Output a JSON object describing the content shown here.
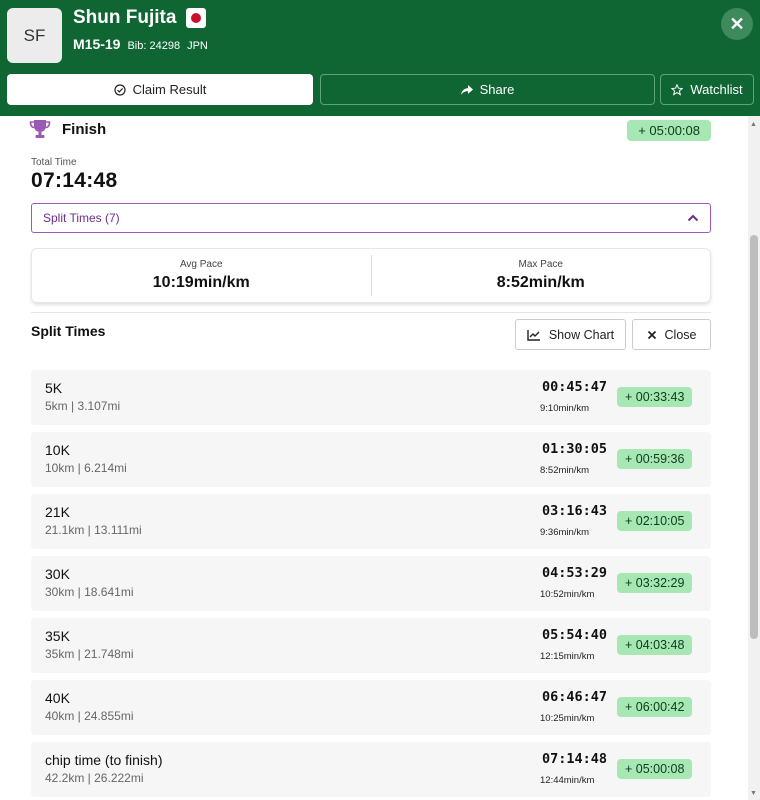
{
  "header": {
    "avatar_initials": "SF",
    "name": "Shun Fujita",
    "flag_icon": "japan-flag-icon",
    "category": "M15-19",
    "bib": "Bib: 24298",
    "country": "JPN",
    "claim_label": "Claim Result",
    "share_label": "Share",
    "watchlist_label": "Watchlist",
    "brand_color": "#0f6633"
  },
  "result": {
    "finish_label": "Finish",
    "finish_diff": "+ 05:00:08",
    "total_time_label": "Total Time",
    "total_time": "07:14:48",
    "split_toggle_label": "Split Times (7)",
    "avg_pace_label": "Avg Pace",
    "avg_pace": "10:19min/km",
    "max_pace_label": "Max Pace",
    "max_pace": "8:52min/km"
  },
  "splits": {
    "title": "Split Times",
    "show_chart_label": "Show Chart",
    "close_label": "Close",
    "rows": [
      {
        "name": "5K",
        "dist": "5km | 3.107mi",
        "time": "00:45:47",
        "pace": "9:10min/km",
        "diff": "+ 00:33:43"
      },
      {
        "name": "10K",
        "dist": "10km | 6.214mi",
        "time": "01:30:05",
        "pace": "8:52min/km",
        "diff": "+ 00:59:36"
      },
      {
        "name": "21K",
        "dist": "21.1km | 13.111mi",
        "time": "03:16:43",
        "pace": "9:36min/km",
        "diff": "+ 02:10:05"
      },
      {
        "name": "30K",
        "dist": "30km | 18.641mi",
        "time": "04:53:29",
        "pace": "10:52min/km",
        "diff": "+ 03:32:29"
      },
      {
        "name": "35K",
        "dist": "35km | 21.748mi",
        "time": "05:54:40",
        "pace": "12:15min/km",
        "diff": "+ 04:03:48"
      },
      {
        "name": "40K",
        "dist": "40km | 24.855mi",
        "time": "06:46:47",
        "pace": "10:25min/km",
        "diff": "+ 06:00:42"
      },
      {
        "name": "chip time (to finish)",
        "dist": "42.2km | 26.222mi",
        "time": "07:14:48",
        "pace": "12:44min/km",
        "diff": "+ 05:00:08"
      }
    ]
  }
}
